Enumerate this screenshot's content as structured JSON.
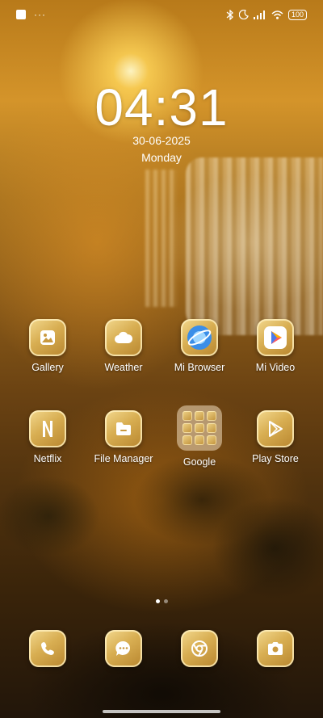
{
  "status_bar": {
    "notification_dots": "···",
    "battery_level": "100",
    "icons": [
      "notification-square-icon",
      "bluetooth-icon",
      "moon-icon",
      "signal-icon",
      "wifi-icon",
      "battery-icon"
    ]
  },
  "lockscreen": {
    "time": "04:31",
    "date": "30-06-2025",
    "weekday": "Monday"
  },
  "apps_row1": [
    {
      "label": "Gallery",
      "icon": "gallery-icon"
    },
    {
      "label": "Weather",
      "icon": "cloud-icon"
    },
    {
      "label": "Mi Browser",
      "icon": "browser-icon"
    },
    {
      "label": "Mi Video",
      "icon": "play-icon"
    }
  ],
  "apps_row2": [
    {
      "label": "Netflix",
      "icon": "netflix-icon"
    },
    {
      "label": "File Manager",
      "icon": "folder-icon"
    },
    {
      "label": "Google",
      "icon": "folder-group-icon"
    },
    {
      "label": "Play Store",
      "icon": "play-store-icon"
    }
  ],
  "pager": {
    "pages": 2,
    "active": 1
  },
  "dock": [
    {
      "icon": "phone-icon"
    },
    {
      "icon": "message-icon"
    },
    {
      "icon": "chrome-icon"
    },
    {
      "icon": "camera-icon"
    }
  ],
  "colors": {
    "icon_gold": "#d8ae52",
    "icon_highlight": "#f3d98f"
  }
}
